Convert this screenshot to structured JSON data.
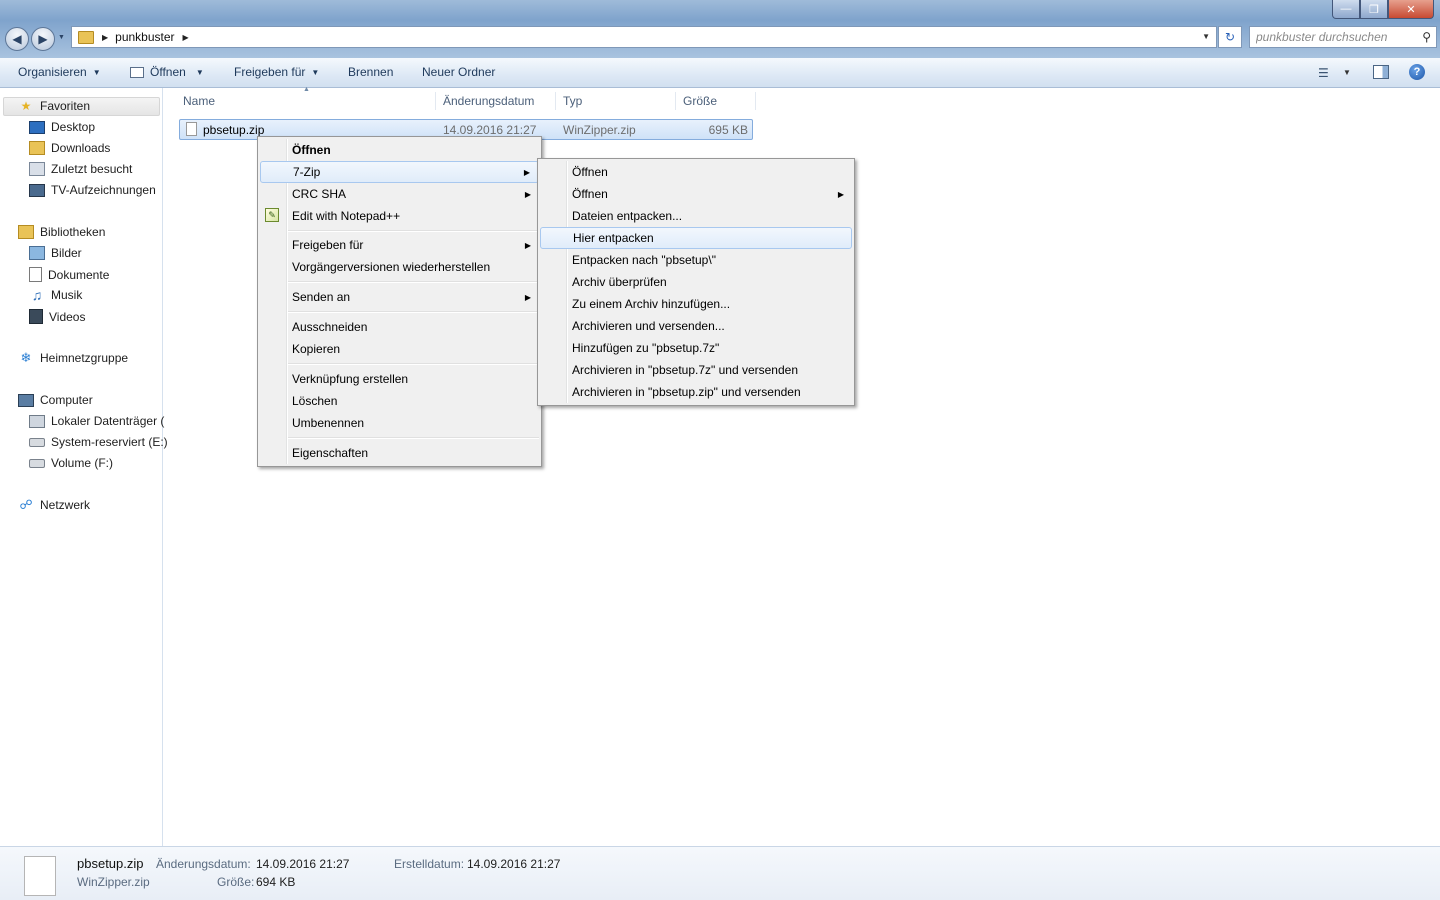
{
  "window": {
    "controls": {
      "minimize": "—",
      "maximize": "❐",
      "close": "✕"
    }
  },
  "address": {
    "crumb": "punkbuster",
    "search_placeholder": "punkbuster durchsuchen"
  },
  "toolbar": {
    "organize": "Organisieren",
    "open": "Öffnen",
    "share": "Freigeben für",
    "burn": "Brennen",
    "new_folder": "Neuer Ordner"
  },
  "sidebar": {
    "favorites": {
      "label": "Favoriten",
      "items": [
        "Desktop",
        "Downloads",
        "Zuletzt besucht",
        "TV-Aufzeichnungen"
      ]
    },
    "libraries": {
      "label": "Bibliotheken",
      "items": [
        "Bilder",
        "Dokumente",
        "Musik",
        "Videos"
      ]
    },
    "homegroup": "Heimnetzgruppe",
    "computer": {
      "label": "Computer",
      "items": [
        "Lokaler Datenträger (",
        "System-reserviert (E:)",
        "Volume (F:)"
      ]
    },
    "network": "Netzwerk"
  },
  "columns": {
    "name": "Name",
    "date": "Änderungsdatum",
    "type": "Typ",
    "size": "Größe"
  },
  "file": {
    "name": "pbsetup.zip",
    "date": "14.09.2016 21:27",
    "type": "WinZipper.zip",
    "size": "695 KB"
  },
  "context_menu": {
    "open": "Öffnen",
    "sevenzip": "7-Zip",
    "crc": "CRC SHA",
    "notepad": "Edit with Notepad++",
    "share": "Freigeben für",
    "restore": "Vorgängerversionen wiederherstellen",
    "send_to": "Senden an",
    "cut": "Ausschneiden",
    "copy": "Kopieren",
    "shortcut": "Verknüpfung erstellen",
    "delete": "Löschen",
    "rename": "Umbenennen",
    "properties": "Eigenschaften"
  },
  "submenu": [
    "Öffnen",
    "Öffnen",
    "Dateien entpacken...",
    "Hier entpacken",
    "Entpacken nach \"pbsetup\\\"",
    "Archiv überprüfen",
    "Zu einem Archiv hinzufügen...",
    "Archivieren und versenden...",
    "Hinzufügen zu \"pbsetup.7z\"",
    "Archivieren in \"pbsetup.7z\" und versenden",
    "Archivieren in \"pbsetup.zip\" und versenden"
  ],
  "details": {
    "name": "pbsetup.zip",
    "type": "WinZipper.zip",
    "modified_label": "Änderungsdatum:",
    "modified": "14.09.2016 21:27",
    "size_label": "Größe:",
    "size": "694 KB",
    "created_label": "Erstelldatum:",
    "created": "14.09.2016 21:27"
  },
  "colors": {
    "accent": "#cfe2f8",
    "highlight_border": "#a8c8ef",
    "link_text": "#1e395b"
  }
}
